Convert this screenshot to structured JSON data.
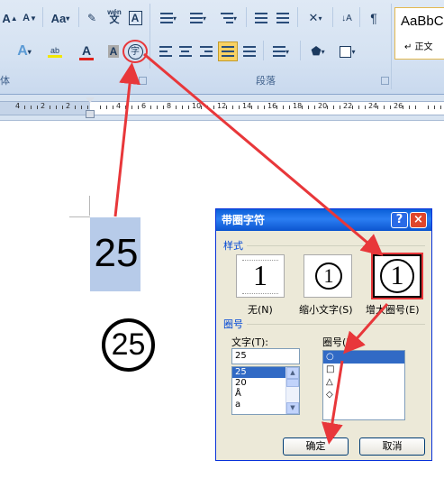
{
  "ribbon": {
    "font_row1": [
      "A",
      "A",
      "Aa"
    ],
    "wen": "wén",
    "font_row2_color": "A",
    "char_shading": "A",
    "enclose_char": "字",
    "paragraph_group_label": "段落",
    "font_group_label": "体",
    "style_preview": "AaBbC",
    "style_name": "↵ 正文"
  },
  "ruler": {
    "numbers": [
      "4",
      "2",
      "2",
      "4",
      "6",
      "8",
      "10",
      "12",
      "14",
      "16",
      "18",
      "20",
      "22",
      "24",
      "26"
    ]
  },
  "document": {
    "plain_text": "25",
    "circled_text": "25"
  },
  "dialog": {
    "title": "带圈字符",
    "help_label": "?",
    "close_label": "×",
    "style_section": "样式",
    "styles": [
      {
        "label": "无(N)",
        "glyph": "1"
      },
      {
        "label": "缩小文字(S)",
        "glyph": "1"
      },
      {
        "label": "增大圈号(E)",
        "glyph": "1"
      }
    ],
    "enclosure_section": "圈号",
    "text_label": "文字(T):",
    "text_value": "25",
    "text_list": [
      "25",
      "20",
      "Å",
      "a"
    ],
    "enclosure_label": "圈号(H):",
    "enclosure_list": [
      "○",
      "□",
      "△",
      "◇"
    ],
    "ok_label": "确定",
    "cancel_label": "取消"
  },
  "colors": {
    "highlight": "#b7cbe9",
    "annotation_arrow": "#e8373a",
    "title_bar": "#0a5fd8"
  }
}
